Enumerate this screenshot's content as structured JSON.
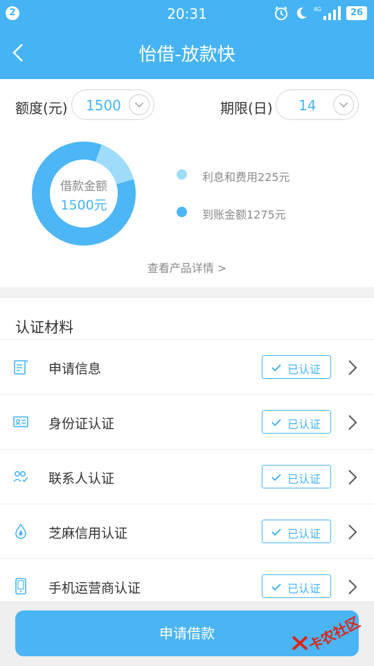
{
  "status_bar": {
    "notification_count": "2",
    "time": "20:31",
    "network": "4G",
    "battery": "26"
  },
  "header": {
    "title": "怡借-放款快"
  },
  "loan": {
    "amount_label": "额度(元)",
    "amount_value": "1500",
    "term_label": "期限(日)",
    "term_value": "14",
    "donut_center_label": "借款金额",
    "donut_center_amount": "1500元",
    "legend": [
      {
        "label": "利息和费用225元",
        "color": "#9fdcfa",
        "value": 225
      },
      {
        "label": "到账金额1275元",
        "color": "#4db6f5",
        "value": 1275
      }
    ],
    "detail_link": "查看产品详情 >"
  },
  "verification": {
    "section_title": "认证材料",
    "status_label": "已认证",
    "items": [
      {
        "label": "申请信息",
        "icon": "application-form-icon"
      },
      {
        "label": "身份证认证",
        "icon": "id-card-icon"
      },
      {
        "label": "联系人认证",
        "icon": "contacts-icon"
      },
      {
        "label": "芝麻信用认证",
        "icon": "sesame-credit-icon"
      },
      {
        "label": "手机运营商认证",
        "icon": "mobile-phone-icon"
      }
    ]
  },
  "footer": {
    "apply_button": "申请借款"
  },
  "watermark": {
    "text": "卡农社区"
  },
  "colors": {
    "accent": "#46b4f4",
    "accent_light": "#9fdcfa"
  }
}
